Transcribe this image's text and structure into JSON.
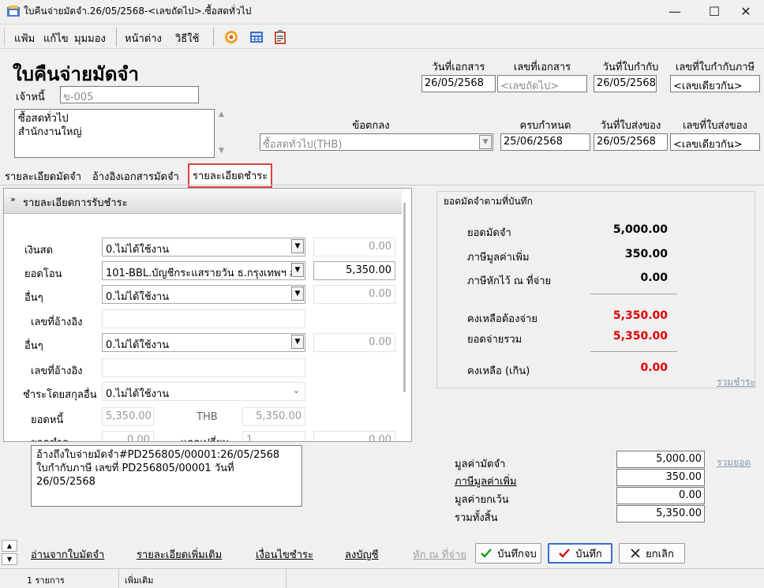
{
  "window": {
    "title": "ใบคืนจ่ายมัดจำ.26/05/2568-<เลขถัดไป>.ซื้อสดทั่วไป",
    "minimize": "—",
    "maximize": "☐",
    "close": "✕"
  },
  "menu": {
    "items": [
      "แฟ้ม",
      "แก้ไข",
      "มุมมอง",
      "หน้าต่าง",
      "วิธีใช้"
    ]
  },
  "header": {
    "title": "ใบคืนจ่ายมัดจำ",
    "creditor_label": "เจ้าหนี้",
    "creditor_placeholder": "ข-005",
    "address_line1": "ซื้อสดทั่วไป",
    "address_line2": "สำนักงานใหญ่",
    "doc_date_label": "วันที่เอกสาร",
    "doc_date": "26/05/2568",
    "doc_no_label": "เลขที่เอกสาร",
    "doc_no": "<เลขถัดไป>",
    "tax_date_label": "วันที่ใบกำกับ",
    "tax_date": "26/05/2568",
    "tax_no_label": "เลขที่ใบกำกับภาษี",
    "tax_no": "<เลขเดียวกัน>",
    "terms_label": "ข้อตกลง",
    "terms_value": "ซื้อสดทั่วไป(THB)",
    "due_label": "ครบกำหนด",
    "due_date": "25/06/2568",
    "delivery_date_label": "วันที่ใบส่งของ",
    "delivery_date": "26/05/2568",
    "delivery_no_label": "เลขที่ใบส่งของ",
    "delivery_no": "<เลขเดียวกัน>"
  },
  "tabs": [
    "รายละเอียดมัดจำ",
    "อ้างอิงเอกสารมัดจำ",
    "รายละเอียดชำระ"
  ],
  "payment": {
    "section_title": "รายละเอียดการรับชำระ",
    "cash_label": "เงินสด",
    "cash_option": "0.ไม่ได้ใช้งาน",
    "cash_amount": "0.00",
    "transfer_label": "ยอดโอน",
    "transfer_option": "101-BBL.บัญชีกระแสรายวัน ธ.กรุงเทพฯ ส",
    "transfer_amount": "5,350.00",
    "other1_label": "อื่นๆ",
    "other1_option": "0.ไม่ได้ใช้งาน",
    "other1_amount": "0.00",
    "ref1_label": "เลขที่อ้างอิง",
    "other2_label": "อื่นๆ",
    "other2_option": "0.ไม่ได้ใช้งาน",
    "other2_amount": "0.00",
    "ref2_label": "เลขที่อ้างอิง",
    "currency_label": "ชำระโดยสกุลอื่น",
    "currency_option": "0.ไม่ได้ใช้งาน",
    "debt_label": "ยอดหนี้",
    "debt_amount": "5,350.00",
    "currency_code": "THB",
    "debt_thb": "5,350.00",
    "paid_label": "ยอดชำระ",
    "paid_amount": "0.00",
    "exchange_label": "แลกเปลี่ยน",
    "exchange_rate": "1",
    "paid_thb": "0.00"
  },
  "summary": {
    "title": "ยอดมัดจำตามที่บันทึก",
    "deposit_label": "ยอดมัดจำ",
    "deposit_value": "5,000.00",
    "vat_label": "ภาษีมูลค่าเพิ่ม",
    "vat_value": "350.00",
    "wht_label": "ภาษีหักไว้ ณ ที่จ่าย",
    "wht_value": "0.00",
    "remain_label": "คงเหลือต้องจ่าย",
    "remain_value": "5,350.00",
    "total_pay_label": "ยอดจ่ายรวม",
    "total_pay_value": "5,350.00",
    "balance_label": "คงเหลือ (เกิน)",
    "balance_value": "0.00",
    "sum_pay_link": "รวมชำระ"
  },
  "note": {
    "line1": "อ้างถึงใบจ่ายมัดจำ#PD256805/00001:26/05/2568",
    "line2": "ใบกำกับภาษี เลขที่ PD256805/00001 วันที่",
    "line3": "26/05/2568"
  },
  "totals": {
    "deposit_label": "มูลค่ามัดจำ",
    "deposit_value": "5,000.00",
    "vat_label": "ภาษีมูลค่าเพิ่ม",
    "vat_value": "350.00",
    "exempt_label": "มูลค่ายกเว้น",
    "exempt_value": "0.00",
    "total_label": "รวมทั้งสิ้น",
    "total_value": "5,350.00",
    "sum_link": "รวมยอด"
  },
  "actions": {
    "read_deposit": "อ่านจากใบมัดจำ",
    "more_details": "รายละเอียดเพิ่มเติม",
    "pay_terms": "เงื่อนไขชำระ",
    "post_ledger": "ลงบัญชี",
    "wht_link": "หัก ณ ที่จ่าย",
    "save_close": "บันทึกจบ",
    "save": "บันทึก",
    "cancel": "ยกเลิก"
  },
  "status": {
    "count": "1 รายการ",
    "mode": "เพิ่มเติม"
  },
  "colors": {
    "accent_red": "#e00000",
    "tab_highlight": "#e04040",
    "check_green": "#1a9a1a"
  }
}
